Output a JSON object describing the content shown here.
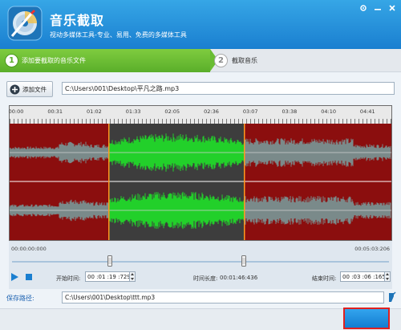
{
  "header": {
    "title": "音乐截取",
    "subtitle": "视动多媒体工具-专业、易用、免费的多媒体工具",
    "icon": "cd-disc-icon"
  },
  "window_controls": [
    "settings-icon",
    "minimize-icon",
    "close-icon"
  ],
  "steps": [
    {
      "num": "1",
      "label": "添加要截取的音乐文件",
      "active": true
    },
    {
      "num": "2",
      "label": "截取音乐",
      "active": false
    }
  ],
  "file": {
    "add_label": "添加文件",
    "path": "C:\\Users\\001\\Desktop\\平凡之路.mp3"
  },
  "timeline": {
    "labels": [
      "00:00",
      "00:31",
      "01:02",
      "01:33",
      "02:05",
      "02:36",
      "03:07",
      "03:38",
      "04:10",
      "04:41"
    ]
  },
  "selection": {
    "start_fraction": 0.26,
    "end_fraction": 0.615
  },
  "playback": {
    "start_display": "00:00:00:000",
    "end_display": "00:05:03:206",
    "start_label": "开始时间:",
    "start_value": "00 :01 :19 :729",
    "duration_label": "时间长度:",
    "duration_value": "00:01:46:436",
    "end_label": "结束时间:",
    "end_value": "00 :03 :06 :165"
  },
  "save": {
    "label": "保存路径:",
    "path": "C:\\Users\\001\\Desktop\\ttt.mp3"
  },
  "colors": {
    "header": "#1a8ad6",
    "step_active": "#5aae2a",
    "wave_bg": "#8b0e0e",
    "wave_sel_bg": "#3d3d3d",
    "wave_gray": "#7a8a8a",
    "wave_green": "#22d02a",
    "marker": "#ff9a20",
    "action_border": "#e02020"
  }
}
